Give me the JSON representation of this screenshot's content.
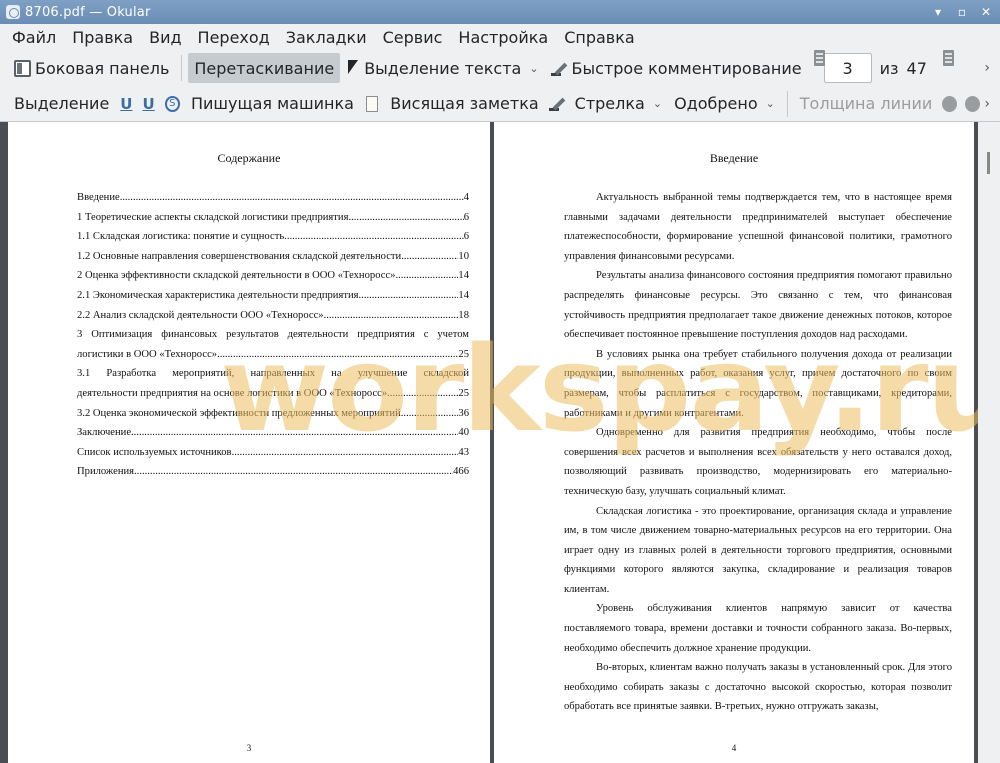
{
  "window": {
    "title": "8706.pdf  — Okular"
  },
  "menu": [
    "Файл",
    "Правка",
    "Вид",
    "Переход",
    "Закладки",
    "Сервис",
    "Настройка",
    "Справка"
  ],
  "toolbar": {
    "sidebar": "Боковая панель",
    "drag": "Перетаскивание",
    "text_select": "Выделение текста",
    "quick_annot": "Быстрое комментирование",
    "page_current": "3",
    "page_of": "из",
    "page_total": "47"
  },
  "annot_bar": {
    "highlight": "Выделение",
    "typewriter": "Пишущая машинка",
    "popup_note": "Висящая заметка",
    "arrow": "Стрелка",
    "stamp": "Одобрено",
    "line_width": "Толщина линии"
  },
  "left_page": {
    "title": "Содержание",
    "page_number": "3",
    "toc": [
      {
        "text": "Введение",
        "page": "4"
      },
      {
        "text": "1 Теоретические аспекты складской логистики предприятия",
        "page": "6"
      },
      {
        "text": "1.1 Складская логистика: понятие и сущность",
        "page": "6"
      },
      {
        "text": "1.2 Основные направления совершенствования складской деятельности",
        "page": "10"
      },
      {
        "text": "2 Оценка эффективности складской деятельности в ООО «Техноросс»",
        "page": "14"
      },
      {
        "text": "2.1 Экономическая характеристика деятельности предприятия",
        "page": "14"
      },
      {
        "text": "2.2 Анализ складской деятельности ООО «Техноросс»",
        "page": "18"
      },
      {
        "text1": "3 Оптимизация финансовых результатов деятельности предприятия с учетом",
        "text": "логистики в ООО «Техноросс»",
        "page": "25"
      },
      {
        "text1": "3.1 Разработка мероприятий, направленных на улучшение складской",
        "text": "деятельности предприятия на основе логистики в ООО «Техноросс»",
        "page": "25"
      },
      {
        "text": "3.2 Оценка экономической эффективности предложенных мероприятий",
        "page": "36"
      },
      {
        "text": "Заключение",
        "page": "40"
      },
      {
        "text": "Список используемых источников",
        "page": "43"
      },
      {
        "text": "Приложения",
        "page": "466"
      }
    ]
  },
  "right_page": {
    "title": "Введение",
    "page_number": "4",
    "paragraphs": [
      "Актуальность выбранной темы подтверждается тем, что в настоящее время главными задачами деятельности предпринимателей выступает обеспечение платежеспособности, формирование успешной финансовой политики, грамотного управления финансовыми ресурсами.",
      "Результаты анализа финансового состояния предприятия помогают правильно распределять финансовые ресурсы. Это связанно с тем, что финансовая устойчивость предприятия предполагает такое движение денежных потоков, которое обеспечивает постоянное превышение поступления доходов над расходами.",
      "В условиях рынка она требует стабильного получения дохода от реализации продукции, выполненных работ, оказания услуг, причем достаточного по своим размерам, чтобы расплатиться с государством, поставщиками, кредиторами, работниками и другими контрагентами.",
      "Одновременно для развития предприятия необходимо, чтобы после совершения всех расчетов и выполнения всех обязательств у него оставался доход, позволяющий развивать производство, модернизировать его материально-техническую базу, улучшать социальный климат.",
      "Складская логистика - это проектирование, организация склада и управление им, в том числе движением товарно-материальных ресурсов на его территории. Она играет одну из главных ролей в деятельности торгового предприятия, основными функциями которого являются закупка, складирование и реализация товаров клиентам.",
      "Уровень обслуживания клиентов напрямую зависит от качества поставляемого товара, времени доставки и точности собранного заказа. Во-первых, необходимо обеспечить должное хранение продукции.",
      "Во-вторых, клиентам важно получать заказы в установленный срок. Для этого необходимо собирать заказы с достаточно высокой скоростью, которая позволит обработать все принятые заявки. В-третьих, нужно отгружать заказы,"
    ]
  },
  "watermark": "workspay.ru"
}
